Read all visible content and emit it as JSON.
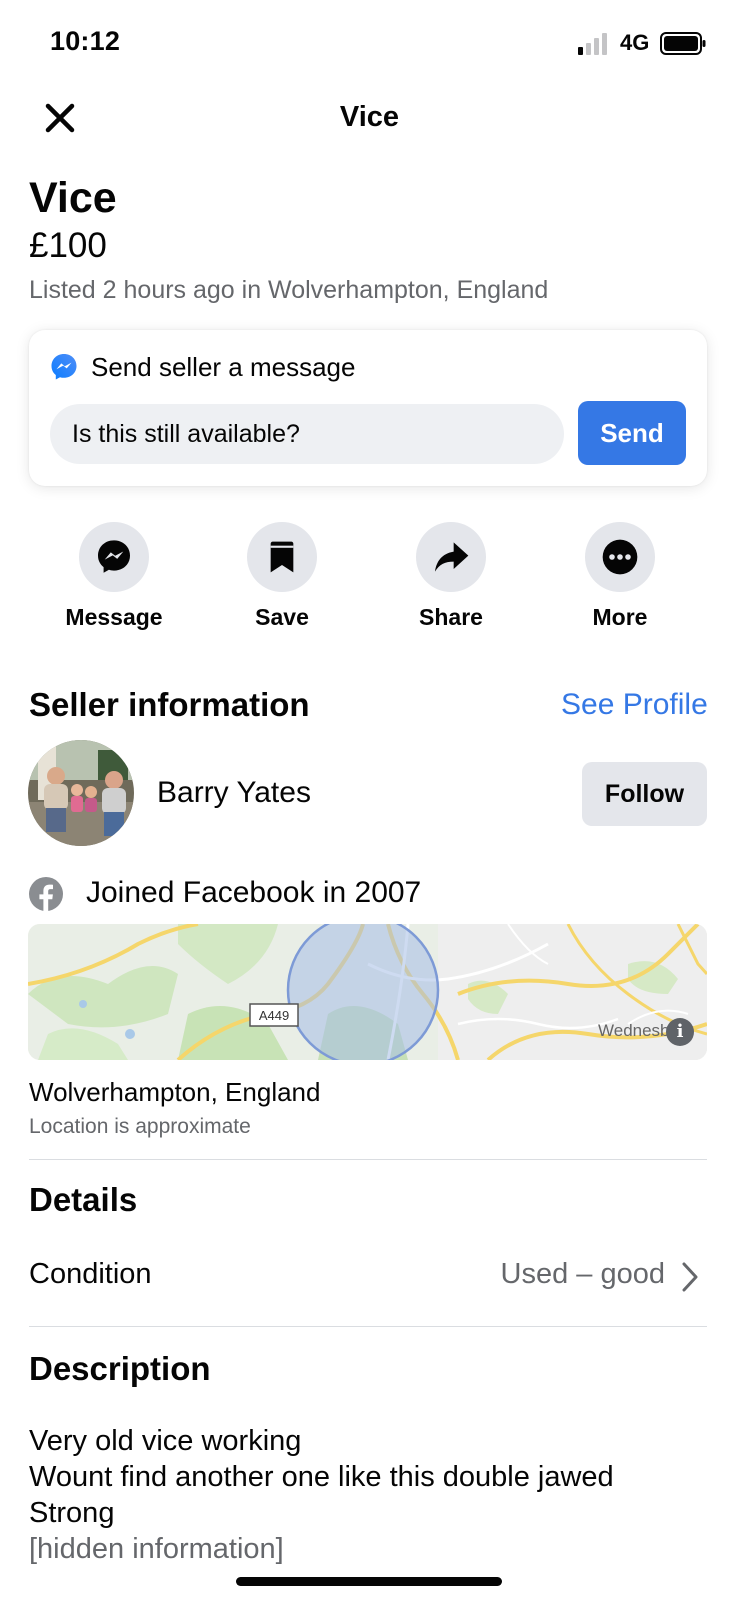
{
  "status_bar": {
    "time": "10:12",
    "network": "4G"
  },
  "nav": {
    "title": "Vice"
  },
  "listing": {
    "title": "Vice",
    "price": "£100",
    "meta": "Listed 2 hours ago in Wolverhampton, England"
  },
  "message_card": {
    "title": "Send seller a message",
    "input_value": "Is this still available?",
    "send_label": "Send"
  },
  "actions": [
    {
      "label": "Message",
      "icon": "messenger-icon"
    },
    {
      "label": "Save",
      "icon": "bookmark-icon"
    },
    {
      "label": "Share",
      "icon": "share-arrow-icon"
    },
    {
      "label": "More",
      "icon": "more-dots-icon"
    }
  ],
  "seller": {
    "section_title": "Seller information",
    "see_profile": "See Profile",
    "name": "Barry Yates",
    "follow_label": "Follow",
    "joined": "Joined Facebook in 2007"
  },
  "location": {
    "road_label": "A449",
    "map_place_label": "Wednesbur",
    "name": "Wolverhampton, England",
    "note": "Location is approximate"
  },
  "details": {
    "section_title": "Details",
    "condition_label": "Condition",
    "condition_value": "Used – good"
  },
  "description": {
    "section_title": "Description",
    "lines": [
      "Very old vice working",
      "Wount find another one like this double jawed",
      "Strong"
    ],
    "hidden": "[hidden information]"
  },
  "colors": {
    "accent": "#3578e5",
    "secondary_text": "#65676b",
    "button_grey": "#e4e6eb",
    "input_grey": "#eef0f3",
    "divider": "#dadde1"
  }
}
